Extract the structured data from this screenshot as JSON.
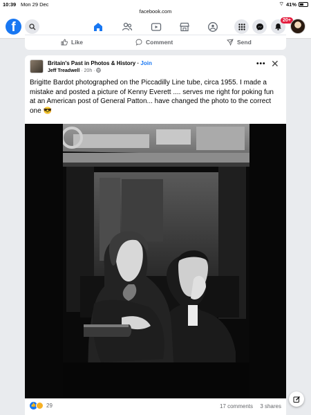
{
  "status_bar": {
    "time": "10:39",
    "date": "Mon 29 Dec",
    "battery": "41%"
  },
  "browser": {
    "url": "facebook.com"
  },
  "nav": {
    "logo": "f",
    "icons": [
      "search-icon",
      "home-icon",
      "friends-icon",
      "video-icon",
      "marketplace-icon",
      "groups-icon",
      "menu-icon",
      "messenger-icon",
      "notifications-icon"
    ],
    "notification_badge": "20+",
    "accent_color": "#1877f2"
  },
  "prev_post_actions": {
    "like": "Like",
    "comment": "Comment",
    "send": "Send"
  },
  "post": {
    "page_name": "Britain's Past in Photos & History",
    "join": "Join",
    "author": "Jeff Treadwell",
    "time": "20h",
    "text": "Brigitte Bardot photographed on the Piccadilly Line tube, circa 1955. I made a mistake and posted a picture of Kenny Everett .... serves me right for poking fun at an American post of General Patton... have changed the photo to the correct one 😎",
    "reaction_count": "29",
    "comments": "17 comments",
    "shares": "3 shares"
  }
}
